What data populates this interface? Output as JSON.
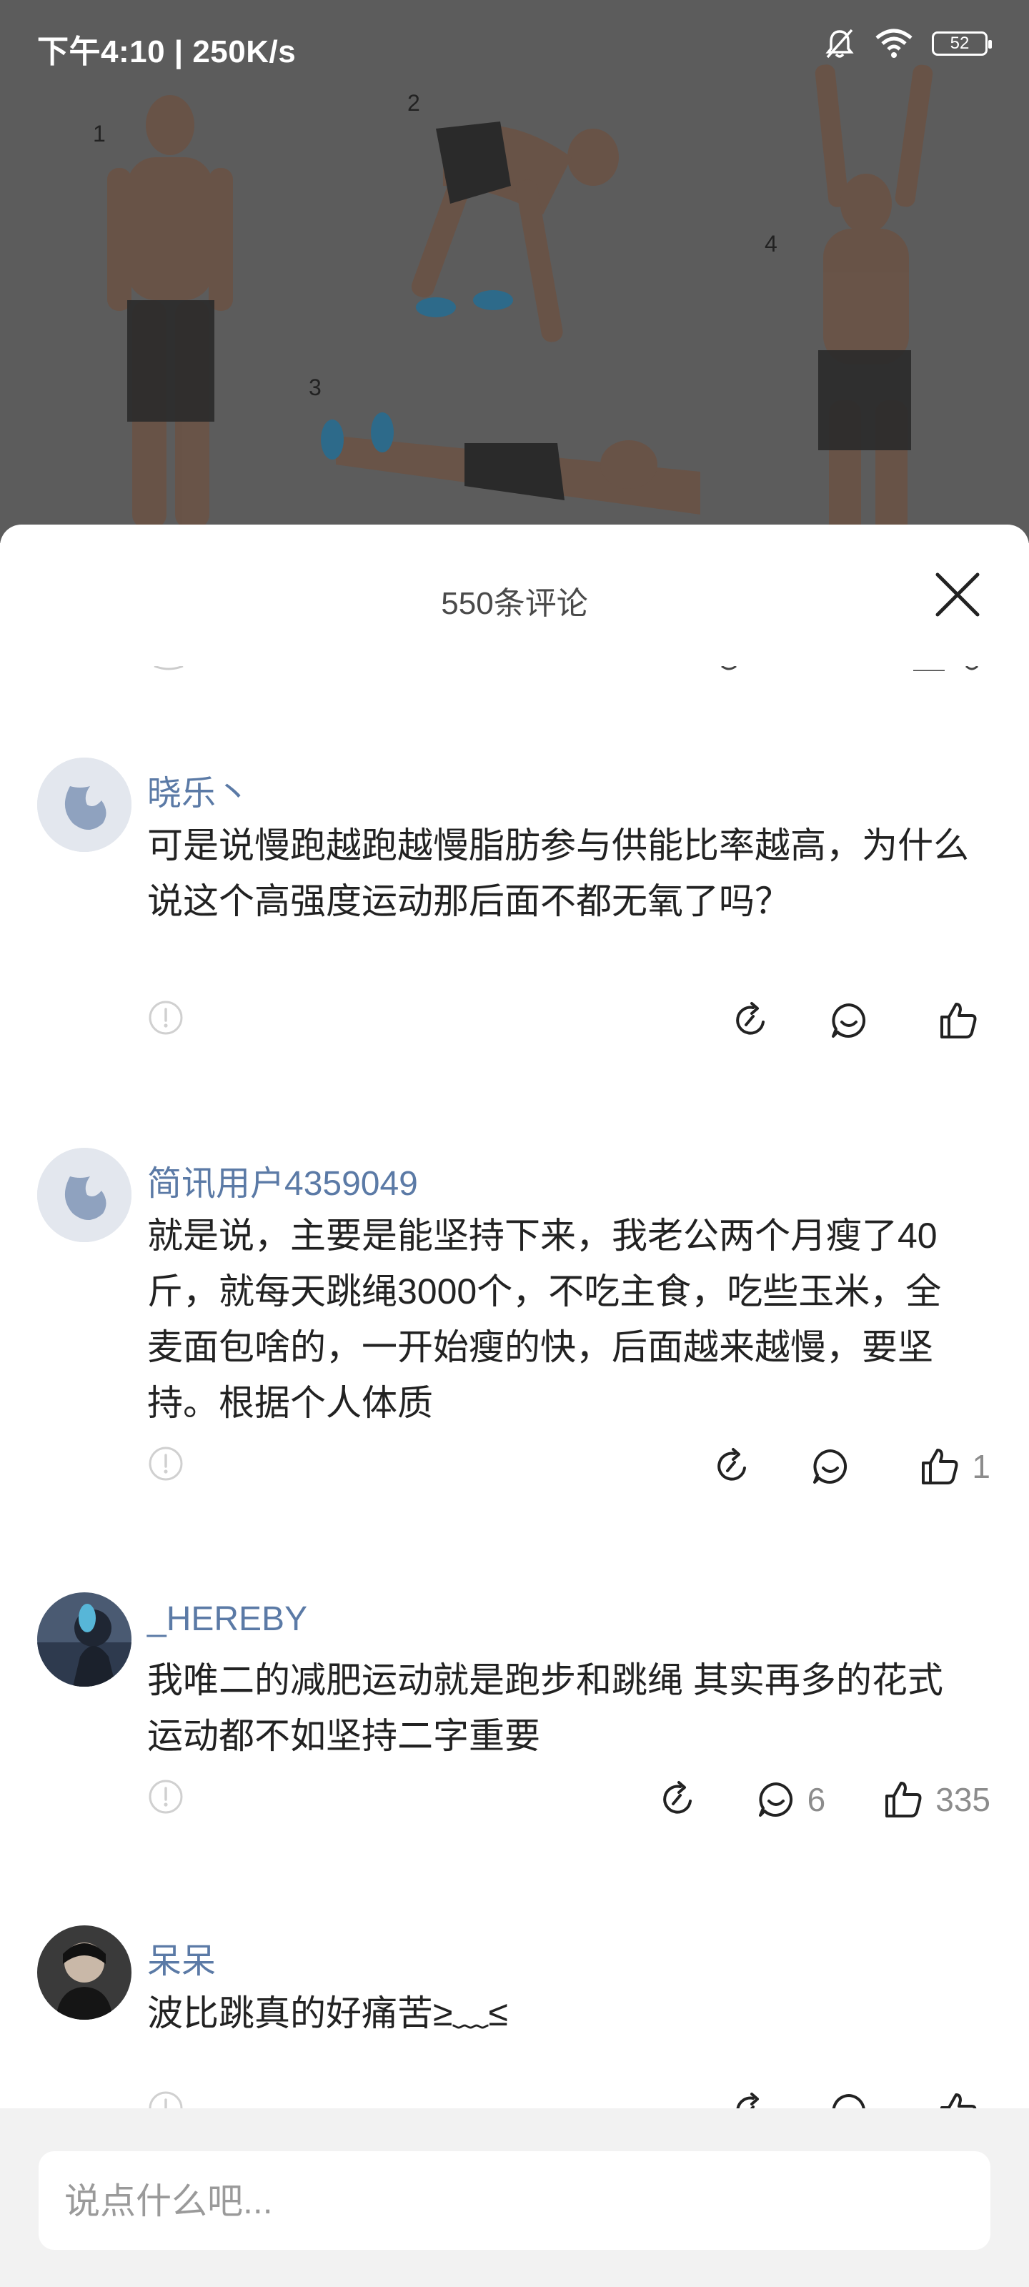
{
  "status_bar": {
    "time_speed": "下午4:10 | 250K/s",
    "battery": "52",
    "icons": [
      "mute-bell-icon",
      "wifi-icon",
      "battery-icon"
    ]
  },
  "background_figure": {
    "step_labels": [
      "1",
      "2",
      "3",
      "4"
    ]
  },
  "sheet": {
    "title": "550条评论",
    "close_icon": "close-icon"
  },
  "comments": [
    {
      "username": "晓乐丶",
      "text": "可是说慢跑越跑越慢脂肪参与供能比率越高，为什么说这个高强度运动那后面不都无氧了吗？",
      "reply_count": "",
      "like_count": ""
    },
    {
      "username": "简讯用户4359049",
      "text": "就是说，主要是能坚持下来，我老公两个月瘦了40斤，就每天跳绳3000个，不吃主食，吃些玉米，全麦面包啥的，一开始瘦的快，后面越来越慢，要坚持。根据个人体质",
      "reply_count": "",
      "like_count": "1"
    },
    {
      "username": "_HEREBY",
      "text": "我唯二的减肥运动就是跑步和跳绳 其实再多的花式运动都不如坚持二字重要",
      "reply_count": "6",
      "like_count": "335"
    },
    {
      "username": "呆呆",
      "text": "波比跳真的好痛苦≥﹏≤",
      "reply_count": "",
      "like_count": ""
    }
  ],
  "input": {
    "placeholder": "说点什么吧..."
  },
  "colors": {
    "username": "#5b7aa6",
    "overlay": "#5c5c5c",
    "input_bar_bg": "#f2f2f2"
  }
}
